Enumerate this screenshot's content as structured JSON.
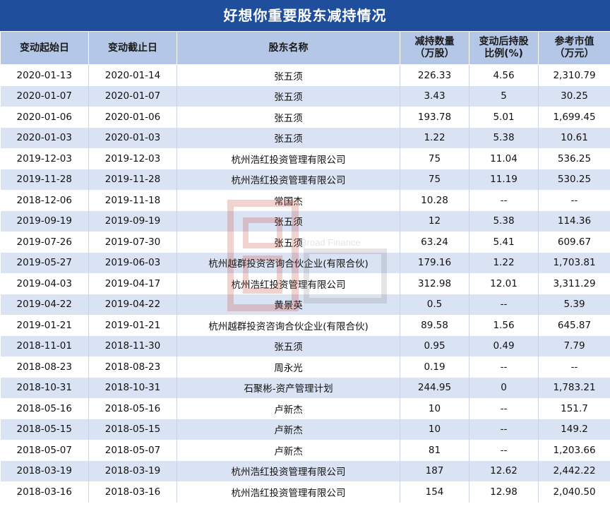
{
  "title": "好想你重要股东减持情况",
  "columns": [
    "变动起始日",
    "变动截止日",
    "股东名称",
    "减持数量\n（万股）",
    "变动后持股\n比例(%)",
    "参考市值\n（万元）"
  ],
  "rows": [
    [
      "2020-01-13",
      "2020-01-14",
      "张五须",
      "226.33",
      "4.56",
      "2,310.79"
    ],
    [
      "2020-01-07",
      "2020-01-07",
      "张五须",
      "3.43",
      "5",
      "30.25"
    ],
    [
      "2020-01-06",
      "2020-01-06",
      "张五须",
      "193.78",
      "5.01",
      "1,699.45"
    ],
    [
      "2020-01-03",
      "2020-01-03",
      "张五须",
      "1.22",
      "5.38",
      "10.61"
    ],
    [
      "2019-12-03",
      "2019-12-03",
      "杭州浩红投资管理有限公司",
      "75",
      "11.04",
      "536.25"
    ],
    [
      "2019-11-28",
      "2019-11-28",
      "杭州浩红投资管理有限公司",
      "75",
      "11.19",
      "530.25"
    ],
    [
      "2018-12-06",
      "2019-11-18",
      "常国杰",
      "10.28",
      "--",
      "--"
    ],
    [
      "2019-09-19",
      "2019-09-19",
      "张五须",
      "12",
      "5.38",
      "114.36"
    ],
    [
      "2019-07-26",
      "2019-07-30",
      "张五须",
      "63.24",
      "5.41",
      "609.67"
    ],
    [
      "2019-05-27",
      "2019-06-03",
      "杭州越群投资咨询合伙企业(有限合伙)",
      "179.16",
      "1.22",
      "1,703.81"
    ],
    [
      "2019-04-03",
      "2019-04-17",
      "杭州浩红投资管理有限公司",
      "312.98",
      "12.01",
      "3,311.29"
    ],
    [
      "2019-04-22",
      "2019-04-22",
      "黄景英",
      "0.5",
      "--",
      "5.39"
    ],
    [
      "2019-01-21",
      "2019-01-21",
      "杭州越群投资咨询合伙企业(有限合伙)",
      "89.58",
      "1.56",
      "645.87"
    ],
    [
      "2018-11-01",
      "2018-11-30",
      "张五须",
      "0.95",
      "0.49",
      "7.79"
    ],
    [
      "2018-08-23",
      "2018-08-23",
      "周永光",
      "0.19",
      "--",
      "--"
    ],
    [
      "2018-10-31",
      "2018-10-31",
      "石聚彬-资产管理计划",
      "244.95",
      "0",
      "1,783.21"
    ],
    [
      "2018-05-16",
      "2018-05-16",
      "卢新杰",
      "10",
      "--",
      "151.7"
    ],
    [
      "2018-05-15",
      "2018-05-15",
      "卢新杰",
      "10",
      "--",
      "149.2"
    ],
    [
      "2018-05-07",
      "2018-05-07",
      "卢新杰",
      "81",
      "--",
      "1,203.66"
    ],
    [
      "2018-03-19",
      "2018-03-19",
      "杭州浩红投资管理有限公司",
      "187",
      "12.62",
      "2,442.22"
    ],
    [
      "2018-03-16",
      "2018-03-16",
      "杭州浩红投资管理有限公司",
      "154",
      "12.98",
      "2,040.50"
    ]
  ],
  "watermark": {
    "text": "Broad Finance",
    "icon": "finance-logo-icon"
  },
  "colors": {
    "title_bg": "#1f4e9c",
    "header_bg": "#b4c7e7",
    "stripe": "#dae3f3"
  }
}
